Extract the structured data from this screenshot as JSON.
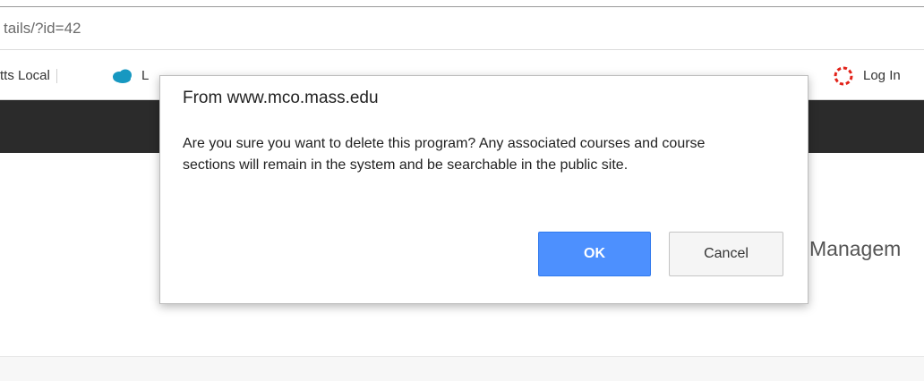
{
  "browser": {
    "address_text": "tails/?id=42",
    "bookmarks": [
      {
        "label": "tts Local",
        "icon": "bookmark-icon"
      },
      {
        "label": "L",
        "icon": "salesforce-cloud-icon"
      },
      {
        "label": "Log In",
        "icon": "ring-icon"
      }
    ]
  },
  "page": {
    "heading": "Managem"
  },
  "dialog": {
    "title": "From www.mco.mass.edu",
    "message": "Are you sure you want to delete this program? Any associated courses and course sections will remain in the system and be searchable in the public site.",
    "ok_label": "OK",
    "cancel_label": "Cancel"
  },
  "colors": {
    "nav_dark": "#2b2b2b",
    "ok_blue": "#4d90fe",
    "salesforce_blue": "#1798c1",
    "ring_red": "#e2231a"
  }
}
